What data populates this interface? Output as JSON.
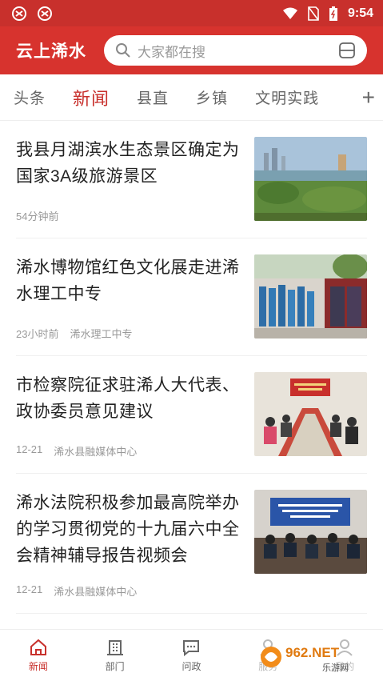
{
  "status": {
    "time": "9:54"
  },
  "header": {
    "title": "云上浠水",
    "search_placeholder": "大家都在搜"
  },
  "tabs": [
    {
      "label": "头条"
    },
    {
      "label": "新闻"
    },
    {
      "label": "县直"
    },
    {
      "label": "乡镇"
    },
    {
      "label": "文明实践"
    }
  ],
  "tab_add": "+",
  "news": [
    {
      "title": "我县月湖滨水生态景区确定为国家3A级旅游景区",
      "time": "54分钟前",
      "source": ""
    },
    {
      "title": "浠水博物馆红色文化展走进浠水理工中专",
      "time": "23小时前",
      "source": "浠水理工中专"
    },
    {
      "title": "市检察院征求驻浠人大代表、政协委员意见建议",
      "time": "12-21",
      "source": "浠水县融媒体中心"
    },
    {
      "title": "浠水法院积极参加最高院举办的学习贯彻党的十九届六中全会精神辅导报告视频会",
      "time": "12-21",
      "source": "浠水县融媒体中心"
    }
  ],
  "bottom_nav": [
    {
      "label": "新闻"
    },
    {
      "label": "部门"
    },
    {
      "label": "问政"
    },
    {
      "label": "服务"
    },
    {
      "label": "我的"
    }
  ],
  "watermark": {
    "text": "962.NET",
    "subtext": "乐游网"
  },
  "colors": {
    "brand": "#d7332e",
    "status_bar": "#c8302c",
    "active_tab": "#c8302c"
  }
}
